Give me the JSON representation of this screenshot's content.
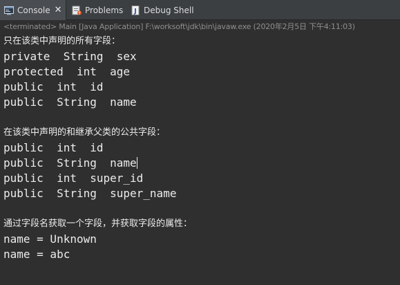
{
  "tabs": [
    {
      "label": "Console",
      "icon": "console-icon",
      "active": true
    },
    {
      "label": "Problems",
      "icon": "problems-icon",
      "active": false
    },
    {
      "label": "Debug Shell",
      "icon": "debug-shell-icon",
      "active": false
    }
  ],
  "close_glyph": "✕",
  "status_text": "<terminated> Main [Java Application] F:\\worksoft\\jdk\\bin\\javaw.exe (2020年2月5日 下午4:11:03)",
  "output": {
    "header1": "只在该类中声明的所有字段：",
    "declared_fields": [
      "private  String  sex",
      "protected  int  age",
      "public  int  id",
      "public  String  name"
    ],
    "header2": "在该类中声明的和继承父类的公共字段：",
    "public_fields": [
      "public  int  id",
      "public  String  name",
      "public  int  super_id",
      "public  String  super_name"
    ],
    "header3": "通过字段名获取一个字段，并获取字段的属性：",
    "field_values": [
      "name = Unknown",
      "name = abc"
    ]
  },
  "colors": {
    "background": "#2f2f2f",
    "tabbar": "#3b3f42",
    "active_tab": "#4a4e52",
    "text": "#ececec",
    "status_text": "#8f8f8f"
  }
}
